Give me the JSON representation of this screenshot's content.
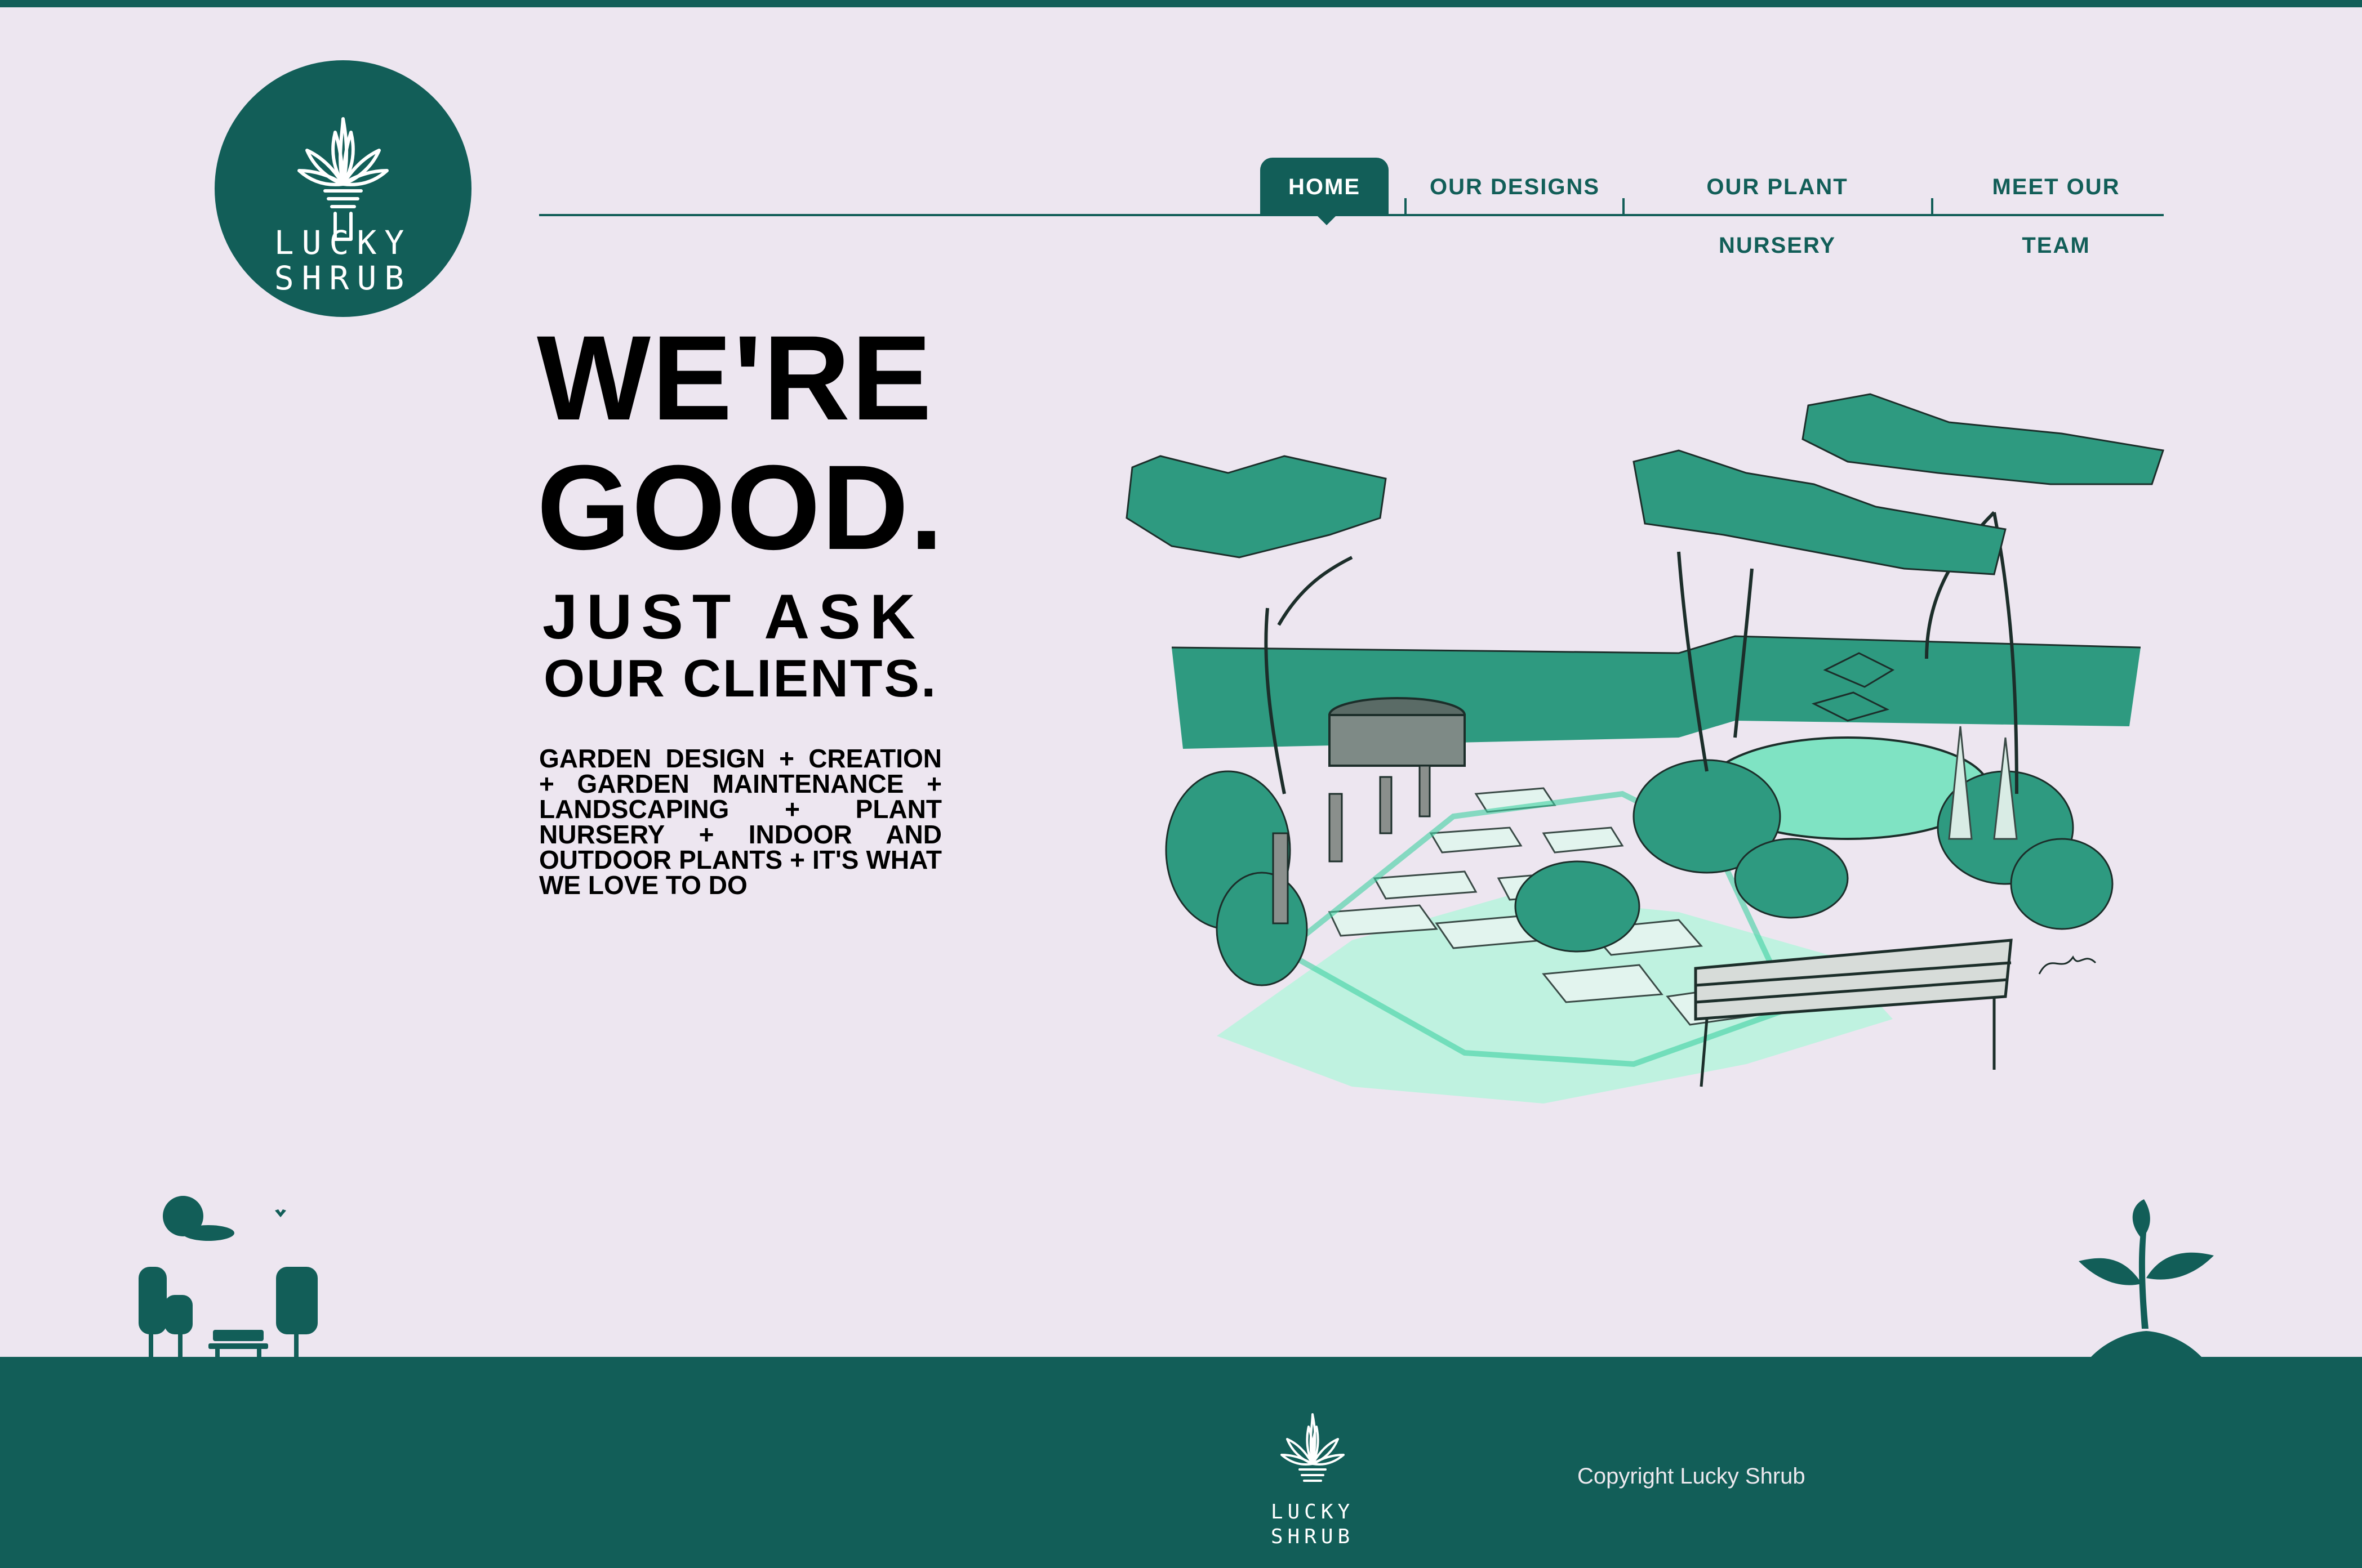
{
  "brand": {
    "line1": "LUCKY",
    "line2": "SHRUB"
  },
  "nav": {
    "items": [
      {
        "label": "HOME",
        "active": true
      },
      {
        "label": "OUR DESIGNS",
        "active": false
      },
      {
        "label": "OUR PLANT NURSERY",
        "active": false
      },
      {
        "label": "MEET OUR TEAM",
        "active": false
      }
    ]
  },
  "hero": {
    "line1": "WE'RE",
    "line2": "GOOD.",
    "sub1": "JUST ASK",
    "sub2": "OUR CLIENTS.",
    "services": "GARDEN DESIGN + CREATION + GARDEN MAINTENANCE + LANDSCAPING + PLANT NURSERY + INDOOR AND OUTDOOR PLANTS + IT'S WHAT WE LOVE TO DO"
  },
  "footer": {
    "copyright": "Copyright Lucky Shrub"
  },
  "icons": {
    "logo": "agave-plant-icon",
    "footer_decoration_left": "park-bench-trees-icon",
    "footer_decoration_right": "sprout-icon"
  },
  "colors": {
    "brand": "#125e58",
    "background": "#ede6f0",
    "illustration_accent": "#2e9a80",
    "illustration_light": "#7fe3c3"
  }
}
